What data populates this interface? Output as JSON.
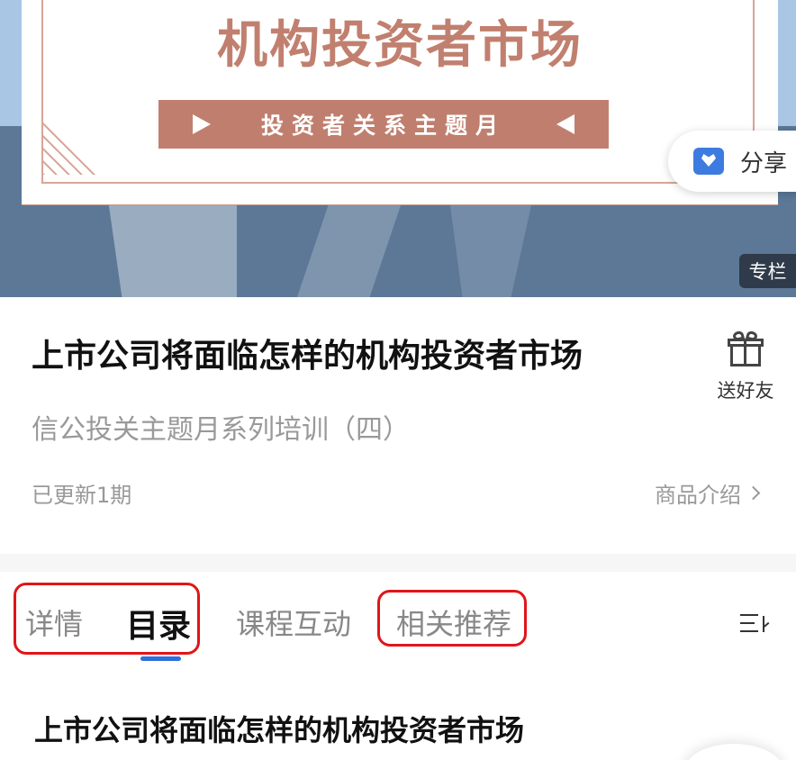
{
  "banner": {
    "title": "机构投资者市场",
    "ribbon": "投资者关系主题月",
    "share_label": "分享",
    "tag": "专栏"
  },
  "course": {
    "title": "上市公司将面临怎样的机构投资者市场",
    "subtitle": "信公投关主题月系列培训（四）",
    "updated": "已更新1期",
    "gift_label": "送好友",
    "intro_link": "商品介绍"
  },
  "tabs": [
    {
      "label": "详情",
      "active": false
    },
    {
      "label": "目录",
      "active": true
    },
    {
      "label": "课程互动",
      "active": false
    },
    {
      "label": "相关推荐",
      "active": false
    }
  ],
  "catalog": {
    "first_item_title": "上市公司将面临怎样的机构投资者市场"
  },
  "colors": {
    "accent": "#2e6fdd",
    "highlight": "#e0151a",
    "banner_text": "#c1806f"
  }
}
